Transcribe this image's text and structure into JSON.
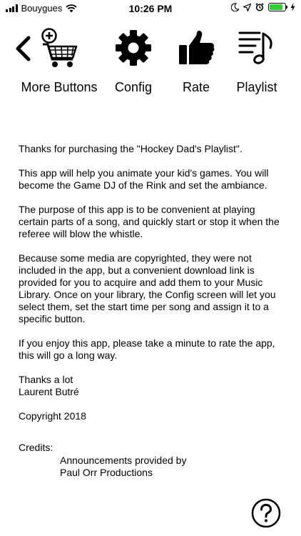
{
  "status_bar": {
    "carrier": "Bouygues",
    "time": "10:26 PM",
    "icons": [
      "signal-icon",
      "wifi-icon",
      "moon-icon",
      "location-icon",
      "alarm-icon",
      "battery-icon",
      "charging-icon"
    ],
    "battery_level": 0.85,
    "battery_color": "#33cc33"
  },
  "toolbar": {
    "back_icon": "chevron-left-icon",
    "items": [
      {
        "label": "More Buttons",
        "icon": "cart-plus-icon"
      },
      {
        "label": "Config",
        "icon": "gear-icon"
      },
      {
        "label": "Rate",
        "icon": "thumbs-up-icon"
      },
      {
        "label": "Playlist",
        "icon": "playlist-icon"
      }
    ]
  },
  "content": {
    "paragraphs": [
      "Thanks for purchasing the \"Hockey Dad's Playlist\".",
      "This app will help you animate your kid's games. You will become the Game DJ of the Rink and set the ambiance.",
      "The purpose of this app is to be convenient at playing certain parts of a song, and quickly start or stop it when the referee will blow the whistle.",
      "Because some media are copyrighted, they were not included in the app, but a convenient download link is provided for you to acquire and add them to your Music Library. Once on your library, the Config screen will let you select them, set the start time per song and assign it to a specific button.",
      "If you enjoy this app, please take a minute to rate the app, this will go a long way."
    ],
    "thanks": "Thanks a lot",
    "author": "Laurent Butré",
    "copyright": "Copyright 2018",
    "credits_title": "Credits:",
    "credits_line1": "Announcements provided by",
    "credits_line2": "Paul Orr Productions"
  },
  "help_icon": "question-circle-icon"
}
